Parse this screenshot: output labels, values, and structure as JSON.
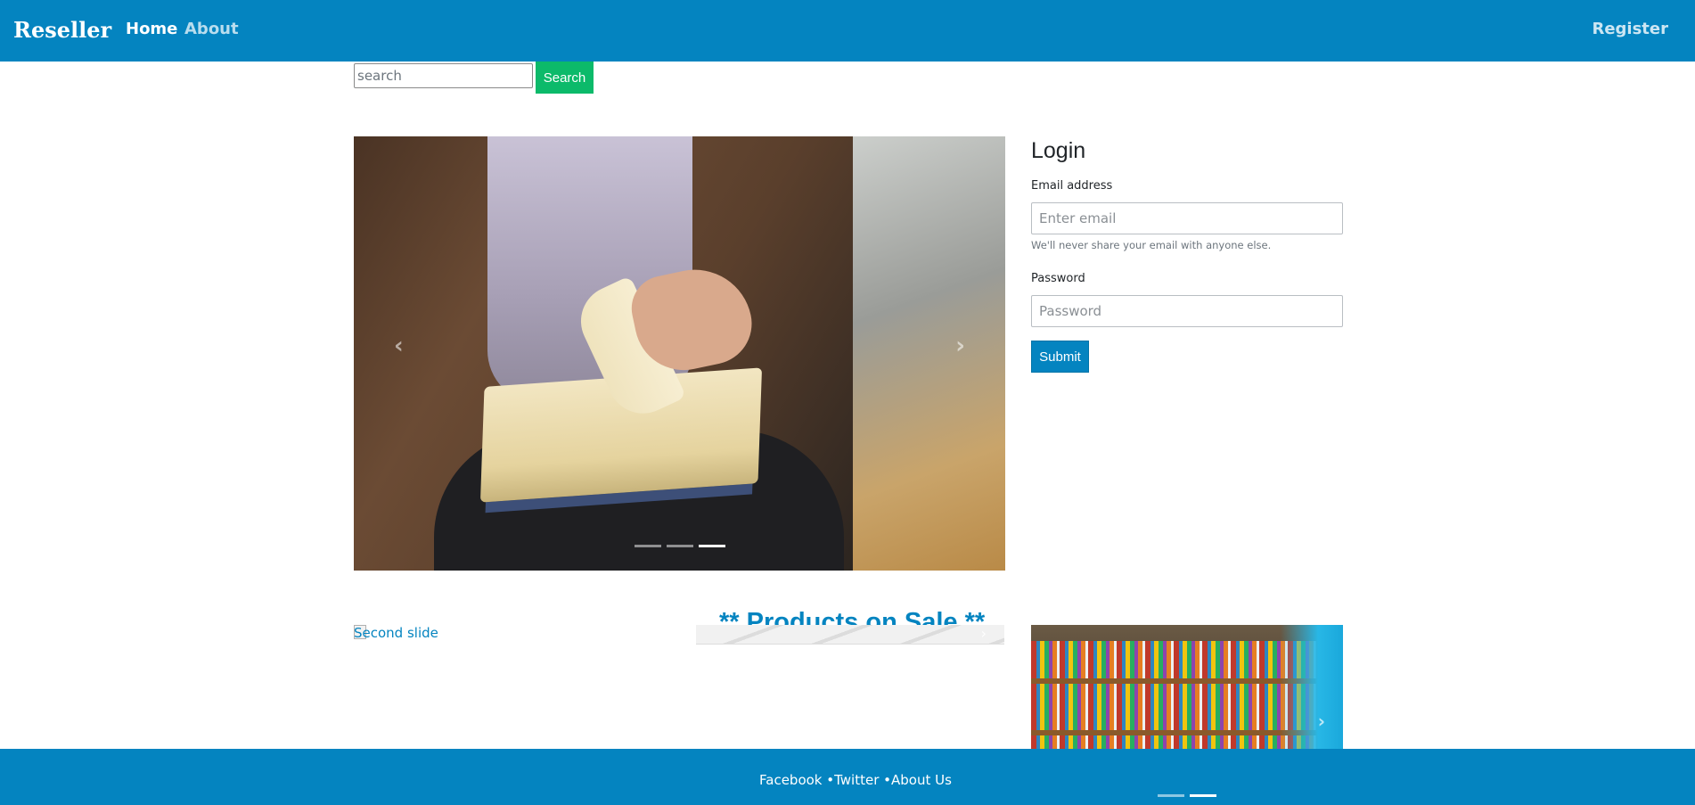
{
  "navbar": {
    "brand": "Reseller",
    "links": [
      {
        "label": "Home",
        "active": true
      },
      {
        "label": "About",
        "active": false
      }
    ],
    "register_label": "Register",
    "background": "#0484c0"
  },
  "search": {
    "placeholder": "search",
    "button_label": "Search",
    "button_color": "#0cba6a"
  },
  "carousel": {
    "prev_icon": "chevron-left-icon",
    "next_icon": "chevron-right-icon",
    "prev_glyph": "‹",
    "next_glyph": "›",
    "indicator_count": 3,
    "active_index": 2
  },
  "login": {
    "title": "Login",
    "email_label": "Email address",
    "email_placeholder": "Enter email",
    "email_help": "We'll never share your email with anyone else.",
    "password_label": "Password",
    "password_placeholder": "Password",
    "submit_label": "Submit"
  },
  "sale": {
    "title": "** Products on Sale **",
    "broken_image_alt": "Second slide",
    "next_glyph": "›"
  },
  "footer": {
    "links": [
      {
        "label": "Facebook"
      },
      {
        "label": "Twitter"
      },
      {
        "label": "About Us"
      }
    ],
    "separator": " •",
    "indicator_count": 2,
    "active_index": 1
  }
}
